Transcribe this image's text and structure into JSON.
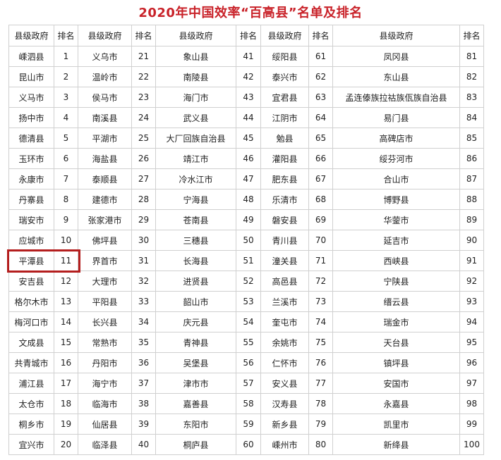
{
  "title": "2020年中国效率“百高县”名单及排名",
  "headers": [
    "县级政府",
    "排名",
    "县级政府",
    "排名",
    "县级政府",
    "排名",
    "县级政府",
    "排名",
    "县级政府",
    "排名"
  ],
  "rows": [
    [
      "嵊泗县",
      "1",
      "义乌市",
      "21",
      "象山县",
      "41",
      "绥阳县",
      "61",
      "凤冈县",
      "81"
    ],
    [
      "昆山市",
      "2",
      "温岭市",
      "22",
      "南陵县",
      "42",
      "泰兴市",
      "62",
      "东山县",
      "82"
    ],
    [
      "义马市",
      "3",
      "侯马市",
      "23",
      "海门市",
      "43",
      "宜君县",
      "63",
      "孟连傣族拉祜族佤族自治县",
      "83"
    ],
    [
      "扬中市",
      "4",
      "南溪县",
      "24",
      "武义县",
      "44",
      "江阴市",
      "64",
      "易门县",
      "84"
    ],
    [
      "德清县",
      "5",
      "平湖市",
      "25",
      "大厂回族自治县",
      "45",
      "勉县",
      "65",
      "高碑店市",
      "85"
    ],
    [
      "玉环市",
      "6",
      "海盐县",
      "26",
      "靖江市",
      "46",
      "灌阳县",
      "66",
      "绥芬河市",
      "86"
    ],
    [
      "永康市",
      "7",
      "泰顺县",
      "27",
      "冷水江市",
      "47",
      "肥东县",
      "67",
      "合山市",
      "87"
    ],
    [
      "丹寨县",
      "8",
      "建德市",
      "28",
      "宁海县",
      "48",
      "乐清市",
      "68",
      "博野县",
      "88"
    ],
    [
      "瑞安市",
      "9",
      "张家港市",
      "29",
      "苍南县",
      "49",
      "磐安县",
      "69",
      "华蓥市",
      "89"
    ],
    [
      "应城市",
      "10",
      "佛坪县",
      "30",
      "三穗县",
      "50",
      "青川县",
      "70",
      "延吉市",
      "90"
    ],
    [
      "平潭县",
      "11",
      "界首市",
      "31",
      "长海县",
      "51",
      "潼关县",
      "71",
      "西峡县",
      "91"
    ],
    [
      "安吉县",
      "12",
      "大理市",
      "32",
      "进贤县",
      "52",
      "高邑县",
      "72",
      "宁陕县",
      "92"
    ],
    [
      "格尔木市",
      "13",
      "平阳县",
      "33",
      "韶山市",
      "53",
      "兰溪市",
      "73",
      "缙云县",
      "93"
    ],
    [
      "梅河口市",
      "14",
      "长兴县",
      "34",
      "庆元县",
      "54",
      "奎屯市",
      "74",
      "瑞金市",
      "94"
    ],
    [
      "文成县",
      "15",
      "常熟市",
      "35",
      "青神县",
      "55",
      "余姚市",
      "75",
      "天台县",
      "95"
    ],
    [
      "共青城市",
      "16",
      "丹阳市",
      "36",
      "吴堡县",
      "56",
      "仁怀市",
      "76",
      "镇坪县",
      "96"
    ],
    [
      "浦江县",
      "17",
      "海宁市",
      "37",
      "津市市",
      "57",
      "安义县",
      "77",
      "安国市",
      "97"
    ],
    [
      "太仓市",
      "18",
      "临海市",
      "38",
      "嘉善县",
      "58",
      "汉寿县",
      "78",
      "永嘉县",
      "98"
    ],
    [
      "桐乡市",
      "19",
      "仙居县",
      "39",
      "东阳市",
      "59",
      "新乡县",
      "79",
      "凯里市",
      "99"
    ],
    [
      "宜兴市",
      "20",
      "临泽县",
      "40",
      "桐庐县",
      "60",
      "嵊州市",
      "80",
      "新绛县",
      "100"
    ]
  ],
  "highlight": {
    "row": 10,
    "color": "#b41e1e"
  }
}
